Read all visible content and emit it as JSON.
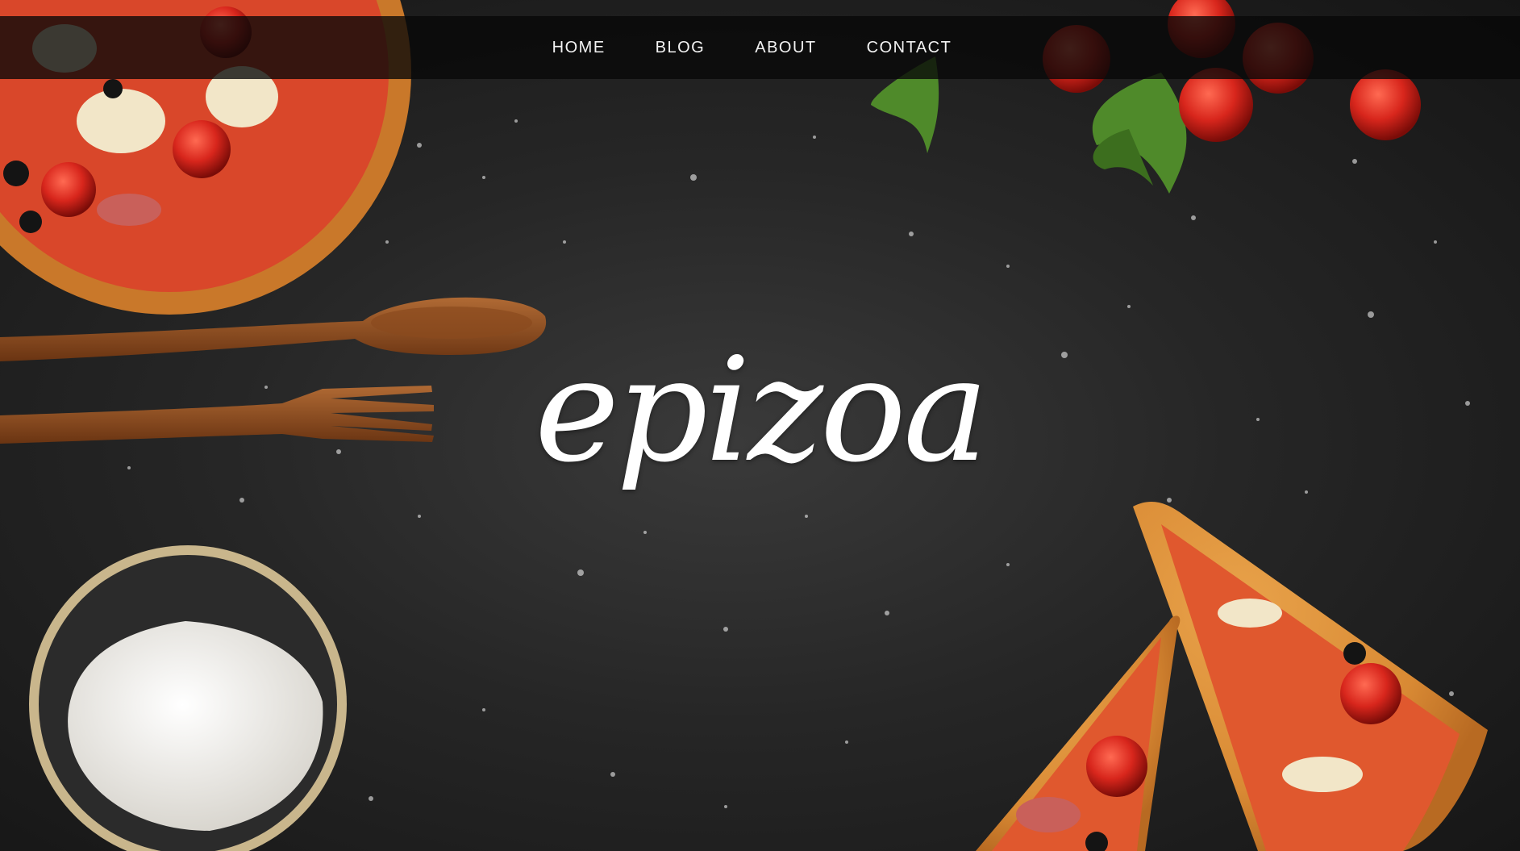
{
  "site": {
    "logo_text": "epizoa"
  },
  "nav": {
    "items": [
      {
        "label": "HOME"
      },
      {
        "label": "BLOG"
      },
      {
        "label": "ABOUT"
      },
      {
        "label": "CONTACT"
      }
    ]
  },
  "colors": {
    "background": "#262626",
    "navbar": "#080808",
    "nav_text": "#f2f2f2",
    "logo_text": "#ffffff",
    "tomato": "#c8201a",
    "wood": "#8a4a1e",
    "flour": "#f4f2ee"
  }
}
